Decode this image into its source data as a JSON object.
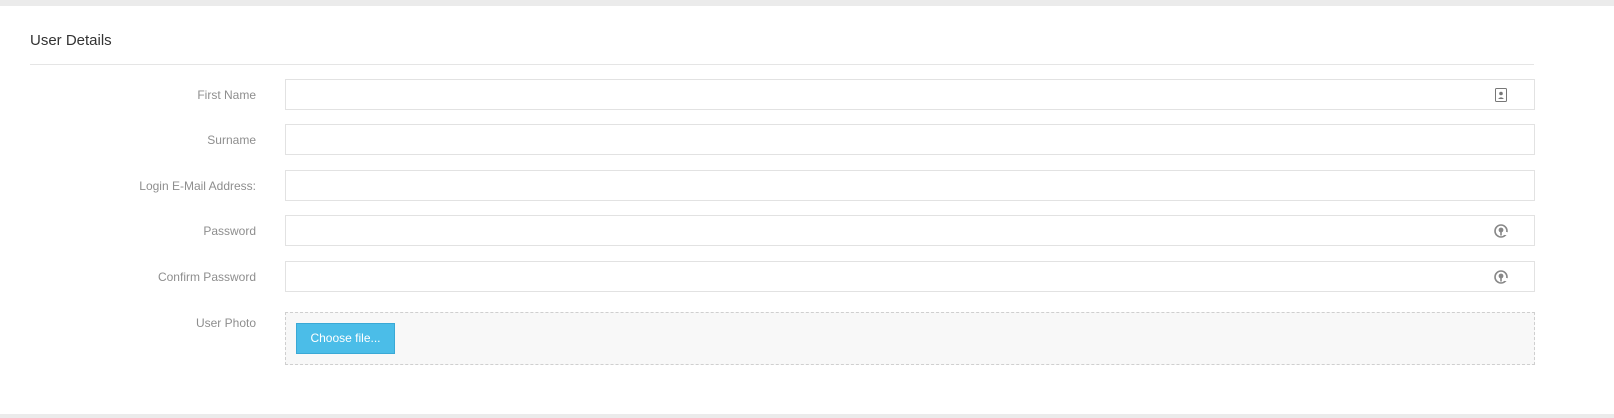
{
  "panel": {
    "title": "User Details"
  },
  "form": {
    "first_name": {
      "label": "First Name",
      "value": "",
      "icon": "contact-card-icon"
    },
    "surname": {
      "label": "Surname",
      "value": ""
    },
    "email": {
      "label": "Login E-Mail Address:",
      "value": ""
    },
    "password": {
      "label": "Password",
      "value": "",
      "icon": "password-key-icon"
    },
    "confirm_password": {
      "label": "Confirm Password",
      "value": "",
      "icon": "password-key-icon"
    },
    "photo": {
      "label": "User Photo",
      "button_label": "Choose file..."
    }
  },
  "colors": {
    "accent": "#4bbde8",
    "label": "#8e8e8e",
    "border": "#e2e2e2"
  }
}
